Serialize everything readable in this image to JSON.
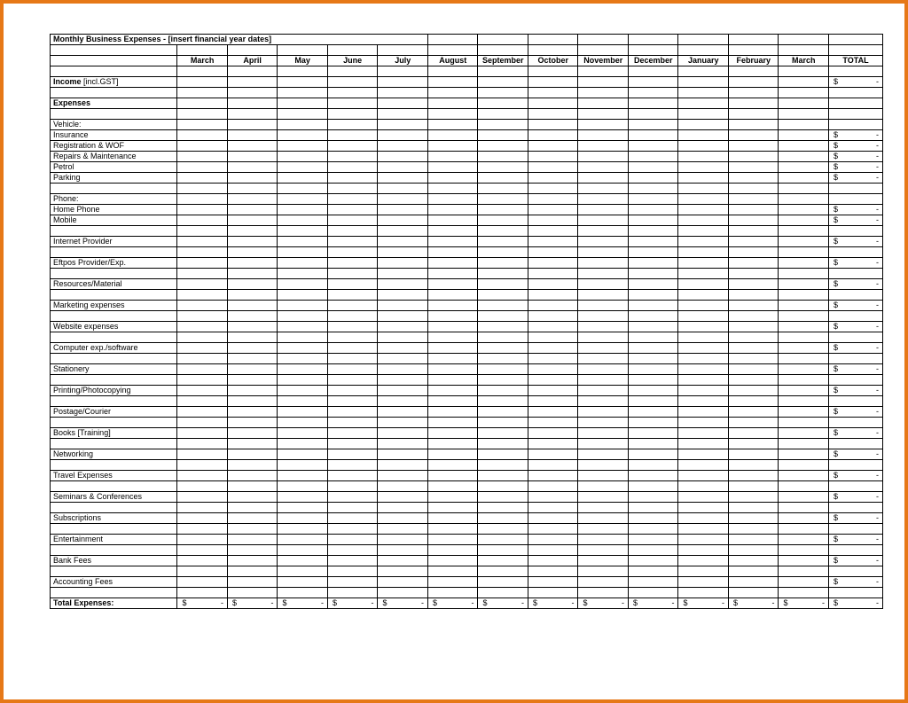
{
  "title_row": "Monthly Business Expenses - [insert financial year dates]",
  "months": [
    "March",
    "April",
    "May",
    "June",
    "July",
    "August",
    "September",
    "October",
    "November",
    "December",
    "January",
    "February",
    "March"
  ],
  "total_label": "TOTAL",
  "income_label": "Income",
  "income_suffix": " [incl.GST]",
  "expenses_label": "Expenses",
  "rows": [
    {
      "type": "category",
      "label": "Vehicle:"
    },
    {
      "type": "sub",
      "label": "Insurance",
      "total": true
    },
    {
      "type": "sub",
      "label": "Registration & WOF",
      "total": true
    },
    {
      "type": "sub",
      "label": "Repairs & Maintenance",
      "total": true
    },
    {
      "type": "sub",
      "label": "Petrol",
      "total": true
    },
    {
      "type": "sub",
      "label": "Parking",
      "total": true
    },
    {
      "type": "blank"
    },
    {
      "type": "category",
      "label": "Phone:"
    },
    {
      "type": "sub",
      "label": "Home Phone",
      "total": true
    },
    {
      "type": "sub",
      "label": "Mobile",
      "total": true
    },
    {
      "type": "blank"
    },
    {
      "type": "item",
      "label": "Internet Provider",
      "total": true
    },
    {
      "type": "blank"
    },
    {
      "type": "item",
      "label": "Eftpos Provider/Exp.",
      "total": true
    },
    {
      "type": "blank"
    },
    {
      "type": "item",
      "label": "Resources/Material",
      "total": true
    },
    {
      "type": "blank"
    },
    {
      "type": "item",
      "label": "Marketing expenses",
      "total": true
    },
    {
      "type": "blank"
    },
    {
      "type": "item",
      "label": "Website expenses",
      "total": true
    },
    {
      "type": "blank"
    },
    {
      "type": "item",
      "label": "Computer exp./software",
      "total": true
    },
    {
      "type": "blank"
    },
    {
      "type": "item",
      "label": "Stationery",
      "total": true
    },
    {
      "type": "blank"
    },
    {
      "type": "item",
      "label": "Printing/Photocopying",
      "total": true
    },
    {
      "type": "blank"
    },
    {
      "type": "item",
      "label": "Postage/Courier",
      "total": true
    },
    {
      "type": "blank"
    },
    {
      "type": "item",
      "label": "Books [Training]",
      "total": true
    },
    {
      "type": "blank"
    },
    {
      "type": "item",
      "label": "Networking",
      "total": true
    },
    {
      "type": "blank"
    },
    {
      "type": "item",
      "label": "Travel Expenses",
      "total": true
    },
    {
      "type": "blank"
    },
    {
      "type": "item",
      "label": "Seminars & Conferences",
      "total": true
    },
    {
      "type": "blank"
    },
    {
      "type": "item",
      "label": "Subscriptions",
      "total": true
    },
    {
      "type": "blank"
    },
    {
      "type": "item",
      "label": "Entertainment",
      "total": true
    },
    {
      "type": "blank"
    },
    {
      "type": "item",
      "label": "Bank Fees",
      "total": true
    },
    {
      "type": "blank"
    },
    {
      "type": "item",
      "label": "Accounting Fees",
      "total": true
    },
    {
      "type": "blank"
    }
  ],
  "total_expenses_label": "Total Expenses:",
  "currency_symbol": "$",
  "dash": "-"
}
